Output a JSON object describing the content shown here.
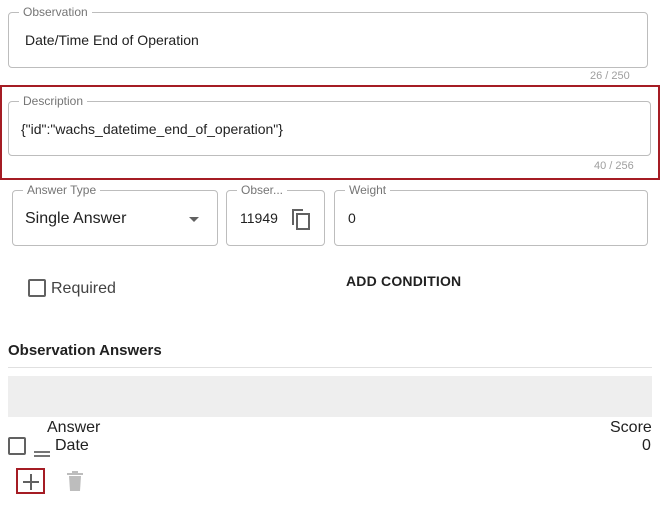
{
  "observation": {
    "legend": "Observation",
    "value": "Date/Time End of Operation",
    "counter": "26 / 250"
  },
  "description": {
    "legend": "Description",
    "value": "{\"id\":\"wachs_datetime_end_of_operation\"}",
    "counter": "40 / 256"
  },
  "answer_type": {
    "legend": "Answer Type",
    "value": "Single Answer"
  },
  "observation_id": {
    "legend": "Obser...",
    "value": "11949"
  },
  "weight": {
    "legend": "Weight",
    "value": "0"
  },
  "required_label": "Required",
  "add_condition_label": "ADD CONDITION",
  "answers_section": {
    "title": "Observation Answers",
    "columns": {
      "answer": "Answer",
      "score": "Score"
    },
    "rows": [
      {
        "answer": "Date",
        "score": "0"
      }
    ]
  },
  "colors": {
    "highlight": "#a51c24",
    "border": "#bdbdbd",
    "muted_text": "#757575"
  },
  "icons": {
    "copy": "copy-icon",
    "dropdown": "chevron-down-icon",
    "add": "plus-icon",
    "delete": "trash-icon",
    "drag": "drag-handle-icon"
  }
}
